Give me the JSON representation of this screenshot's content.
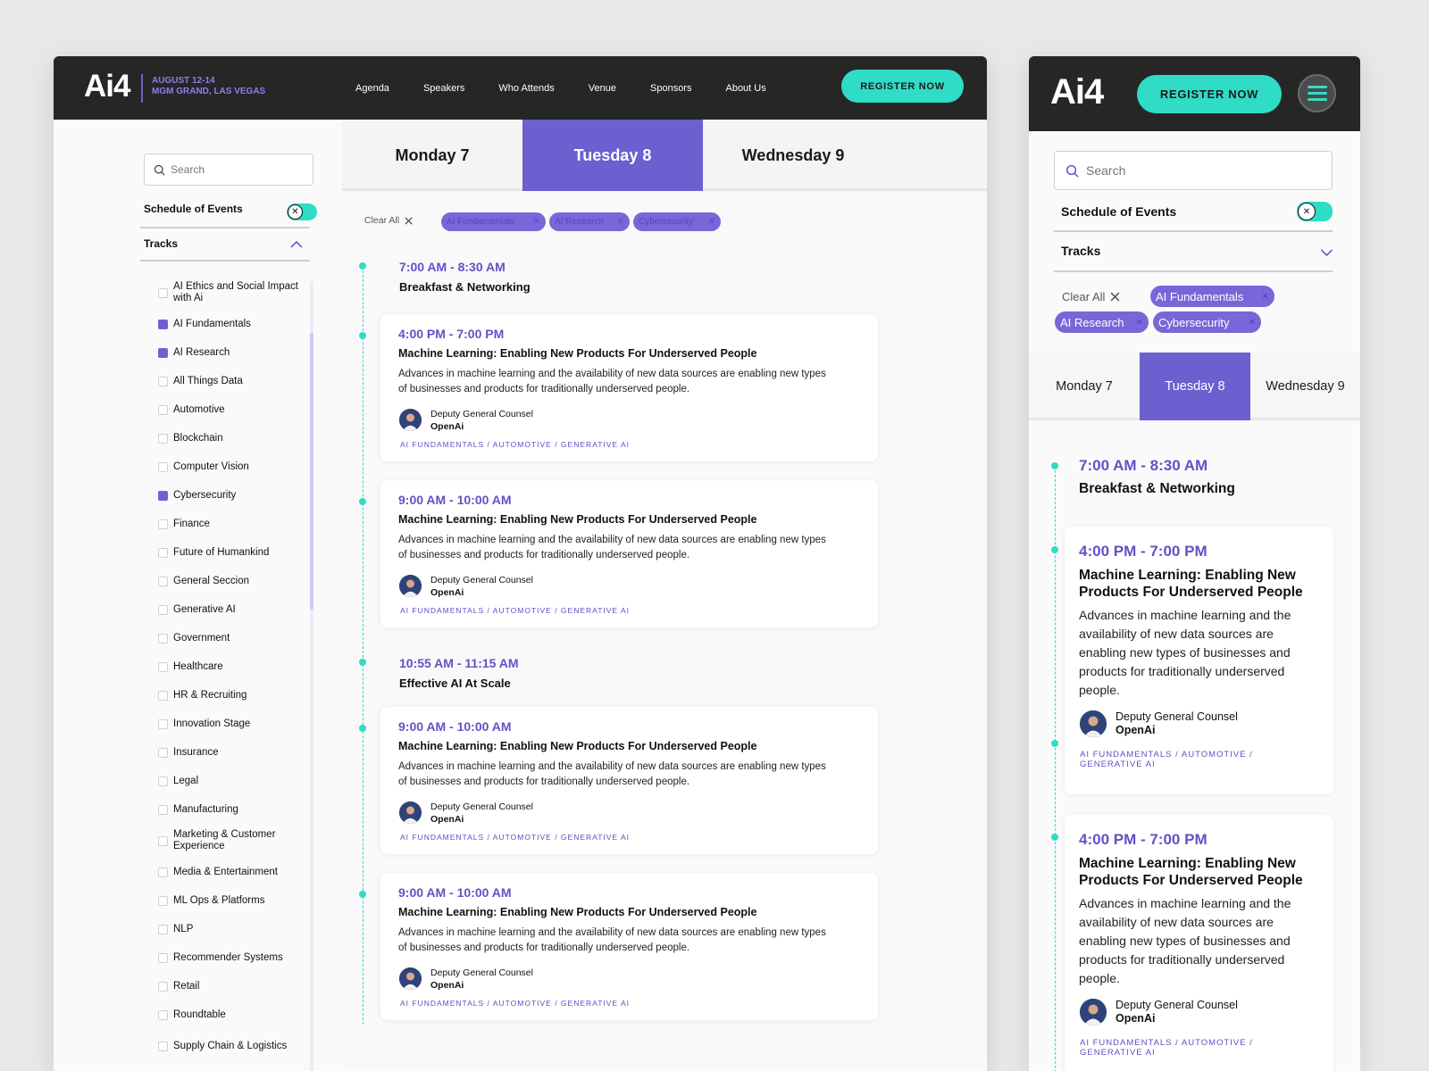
{
  "brand": {
    "logo": "Ai4",
    "event_date": "AUGUST 12-14",
    "event_venue": "MGM GRAND, LAS VEGAS"
  },
  "nav": [
    "Agenda",
    "Speakers",
    "Who Attends",
    "Venue",
    "Sponsors",
    "About Us"
  ],
  "register_label": "REGISTER NOW",
  "search_placeholder": "Search",
  "schedule_toggle_label": "Schedule of Events",
  "toggle_icon": "✕",
  "tracks_label": "Tracks",
  "tracks": [
    {
      "label": "AI Ethics and Social Impact with Ai",
      "checked": false
    },
    {
      "label": "AI Fundamentals",
      "checked": true
    },
    {
      "label": "AI Research",
      "checked": true
    },
    {
      "label": "All Things Data",
      "checked": false
    },
    {
      "label": "Automotive",
      "checked": false
    },
    {
      "label": "Blockchain",
      "checked": false
    },
    {
      "label": "Computer Vision",
      "checked": false
    },
    {
      "label": "Cybersecurity",
      "checked": true
    },
    {
      "label": "Finance",
      "checked": false
    },
    {
      "label": "Future of Humankind",
      "checked": false
    },
    {
      "label": "General Seccion",
      "checked": false
    },
    {
      "label": "Generative AI",
      "checked": false
    },
    {
      "label": "Government",
      "checked": false
    },
    {
      "label": "Healthcare",
      "checked": false
    },
    {
      "label": "HR & Recruiting",
      "checked": false
    },
    {
      "label": "Innovation Stage",
      "checked": false
    },
    {
      "label": "Insurance",
      "checked": false
    },
    {
      "label": "Legal",
      "checked": false
    },
    {
      "label": "Manufacturing",
      "checked": false
    },
    {
      "label": "Marketing & Customer Experience",
      "checked": false
    },
    {
      "label": "Media & Entertainment",
      "checked": false
    },
    {
      "label": "ML Ops & Platforms",
      "checked": false
    },
    {
      "label": "NLP",
      "checked": false
    },
    {
      "label": "Recommender Systems",
      "checked": false
    },
    {
      "label": "Retail",
      "checked": false
    },
    {
      "label": "Roundtable",
      "checked": false
    },
    {
      "label": "Supply Chain & Logistics",
      "checked": false
    }
  ],
  "days": [
    "Monday 7",
    "Tuesday 8",
    "Wednesday 9"
  ],
  "active_day": "Tuesday 8",
  "clear_all_label": "Clear All",
  "filter_chips": [
    "AI Fundamentals",
    "AI Research",
    "Cybersecurity"
  ],
  "sessions": [
    {
      "type": "simple",
      "time": "7:00 AM - 8:30 AM",
      "title": "Breakfast & Networking"
    },
    {
      "type": "card",
      "time": "4:00 PM - 7:00 PM",
      "title": "Machine Learning: Enabling New Products For Underserved People",
      "description": "Advances in machine learning and the availability of new data sources are enabling new types of businesses and products for traditionally underserved people.",
      "speaker_role": "Deputy General Counsel",
      "speaker_org": "OpenAi",
      "tags": "AI FUNDAMENTALS / AUTOMOTIVE / GENERATIVE AI"
    },
    {
      "type": "card",
      "time": "9:00 AM - 10:00 AM",
      "title": "Machine Learning: Enabling New Products For Underserved People",
      "description": "Advances in machine learning and the availability of new data sources are enabling new types of businesses and products for traditionally underserved people.",
      "speaker_role": "Deputy General Counsel",
      "speaker_org": "OpenAi",
      "tags": "AI FUNDAMENTALS / AUTOMOTIVE / GENERATIVE AI"
    },
    {
      "type": "simple",
      "time": "10:55 AM - 11:15 AM",
      "title": "Effective AI At Scale"
    },
    {
      "type": "card",
      "time": "9:00 AM - 10:00 AM",
      "title": "Machine Learning: Enabling New Products For Underserved People",
      "description": "Advances in machine learning and the availability of new data sources are enabling new types of businesses and products for traditionally underserved people.",
      "speaker_role": "Deputy General Counsel",
      "speaker_org": "OpenAi",
      "tags": "AI FUNDAMENTALS / AUTOMOTIVE / GENERATIVE AI"
    },
    {
      "type": "card",
      "time": "9:00 AM - 10:00 AM",
      "title": "Machine Learning: Enabling New Products For Underserved People",
      "description": "Advances in machine learning and the availability of new data sources are enabling new types of businesses and products for traditionally underserved people.",
      "speaker_role": "Deputy General Counsel",
      "speaker_org": "OpenAi",
      "tags": "AI FUNDAMENTALS / AUTOMOTIVE / GENERATIVE AI"
    }
  ],
  "mobile_sessions": [
    {
      "type": "simple",
      "time": "7:00 AM - 8:30 AM",
      "title": "Breakfast & Networking"
    },
    {
      "type": "card",
      "time": "4:00 PM - 7:00 PM",
      "title": "Machine Learning: Enabling New Products For Underserved People",
      "description": "Advances in machine learning and the availability of new data sources are enabling new types of businesses and products for traditionally underserved people.",
      "speaker_role": "Deputy General Counsel",
      "speaker_org": "OpenAi",
      "tags": "AI FUNDAMENTALS / AUTOMOTIVE / GENERATIVE AI"
    },
    {
      "type": "card",
      "time": "4:00 PM - 7:00 PM",
      "title": "Machine Learning: Enabling New Products For Underserved People",
      "description": "Advances in machine learning and the availability of new data sources are enabling new types of businesses and products for traditionally underserved people.",
      "speaker_role": "Deputy General Counsel",
      "speaker_org": "OpenAi",
      "tags": "AI FUNDAMENTALS / AUTOMOTIVE / GENERATIVE AI"
    }
  ],
  "colors": {
    "accent": "#6c5fcf",
    "teal": "#2fdcc6",
    "header_bg": "#262626",
    "chip_bg": "#7767d8"
  }
}
